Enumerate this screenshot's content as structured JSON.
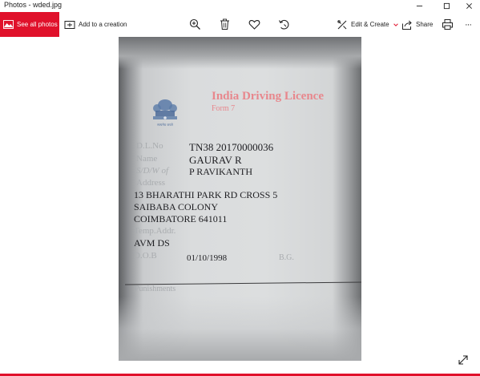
{
  "window": {
    "title": "Photos - wded.jpg",
    "controls": [
      "minimize-icon",
      "maximize-icon",
      "close-icon"
    ]
  },
  "toolbar": {
    "see_all_label": "See all photos",
    "add_label": "Add to a creation",
    "edit_label": "Edit & Create",
    "share_label": "Share",
    "icons": [
      "zoom-icon",
      "delete-icon",
      "heart-icon",
      "rotate-icon",
      "print-icon",
      "more-icon"
    ],
    "more_label": "···"
  },
  "colors": {
    "accent": "#e0112b"
  },
  "card": {
    "heading": "India Driving Licence",
    "form": "Form 7",
    "emblem_caption": "सत्यमेव जयते",
    "fields": [
      {
        "label": "D.L.No",
        "value": "TN38 20170000036"
      },
      {
        "label": "Name",
        "value": "GAURAV R"
      },
      {
        "label": "S/D/W of",
        "value": "P RAVIKANTH"
      },
      {
        "label": "Address",
        "value": ""
      }
    ],
    "address_lines": [
      "13 BHARATHI PARK RD CROSS 5",
      "SAIBABA COLONY",
      "COIMBATORE 641011"
    ],
    "temp_addr_label": "Temp.Addr.",
    "temp_addr_value": "AVM DS",
    "dob_label": "D.O.B",
    "dob_value": "01/10/1998",
    "bg_label": "B.G.",
    "punishments_label": "Punishments"
  }
}
